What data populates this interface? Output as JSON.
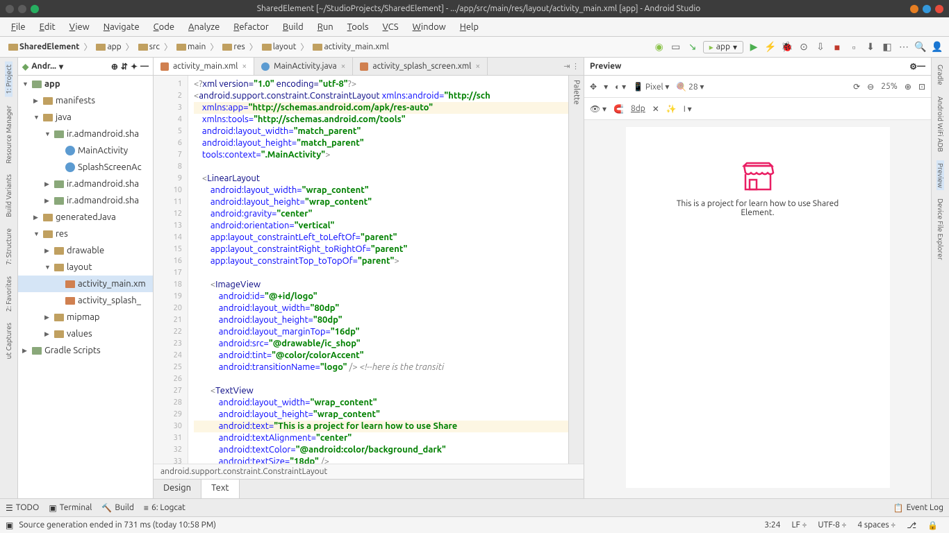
{
  "titlebar": "SharedElement [~/StudioProjects/SharedElement] - .../app/src/main/res/layout/activity_main.xml [app] - Android Studio",
  "menu": [
    "File",
    "Edit",
    "View",
    "Navigate",
    "Code",
    "Analyze",
    "Refactor",
    "Build",
    "Run",
    "Tools",
    "VCS",
    "Window",
    "Help"
  ],
  "breadcrumbs": [
    "SharedElement",
    "app",
    "src",
    "main",
    "res",
    "layout",
    "activity_main.xml"
  ],
  "runconfig": "app",
  "project": {
    "header": "Andr...",
    "nodes": [
      {
        "d": 0,
        "arr": "▼",
        "icon": "pkg",
        "label": "app",
        "bold": true
      },
      {
        "d": 1,
        "arr": "▶",
        "icon": "fic",
        "label": "manifests"
      },
      {
        "d": 1,
        "arr": "▼",
        "icon": "fic",
        "label": "java"
      },
      {
        "d": 2,
        "arr": "▼",
        "icon": "pkg",
        "label": "ir.admandroid.sha"
      },
      {
        "d": 3,
        "arr": "",
        "icon": "cls",
        "label": "MainActivity"
      },
      {
        "d": 3,
        "arr": "",
        "icon": "cls",
        "label": "SplashScreenAc"
      },
      {
        "d": 2,
        "arr": "▶",
        "icon": "pkg",
        "label": "ir.admandroid.sha"
      },
      {
        "d": 2,
        "arr": "▶",
        "icon": "pkg",
        "label": "ir.admandroid.sha"
      },
      {
        "d": 1,
        "arr": "▶",
        "icon": "fic",
        "label": "generatedJava"
      },
      {
        "d": 1,
        "arr": "▼",
        "icon": "fic",
        "label": "res"
      },
      {
        "d": 2,
        "arr": "▶",
        "icon": "fic",
        "label": "drawable"
      },
      {
        "d": 2,
        "arr": "▼",
        "icon": "fic",
        "label": "layout"
      },
      {
        "d": 3,
        "arr": "",
        "icon": "file",
        "label": "activity_main.xm",
        "sel": true
      },
      {
        "d": 3,
        "arr": "",
        "icon": "file",
        "label": "activity_splash_"
      },
      {
        "d": 2,
        "arr": "▶",
        "icon": "fic",
        "label": "mipmap"
      },
      {
        "d": 2,
        "arr": "▶",
        "icon": "fic",
        "label": "values"
      },
      {
        "d": 0,
        "arr": "▶",
        "icon": "pkg",
        "label": "Gradle Scripts"
      }
    ]
  },
  "tabs": [
    {
      "label": "activity_main.xml",
      "active": true,
      "icon": ""
    },
    {
      "label": "MainActivity.java",
      "active": false,
      "icon": "j"
    },
    {
      "label": "activity_splash_screen.xml",
      "active": false,
      "icon": ""
    }
  ],
  "palette_label": "Palette",
  "code_lines": [
    {
      "n": 1,
      "hl": false,
      "html": "<span class='g'>&lt;?</span><span class='t'>xml version=</span><span class='s'>\"1.0\"</span> <span class='t'>encoding=</span><span class='s'>\"utf-8\"</span><span class='g'>?&gt;</span>"
    },
    {
      "n": 2,
      "hl": false,
      "html": "<span class='g'>&lt;</span><span class='t'>android.support.constraint.ConstraintLayout</span> <span class='a'>xmlns:android=</span><span class='s'>\"http://sch</span>"
    },
    {
      "n": 3,
      "hl": true,
      "html": "    <span class='a'>xmlns:app=</span><span class='s'>\"http://schemas.android.com/apk/res-auto\"</span>"
    },
    {
      "n": 4,
      "hl": false,
      "html": "    <span class='a'>xmlns:tools=</span><span class='s'>\"http://schemas.android.com/tools\"</span>"
    },
    {
      "n": 5,
      "hl": false,
      "html": "    <span class='a'>android:layout_width=</span><span class='s'>\"match_parent\"</span>"
    },
    {
      "n": 6,
      "hl": false,
      "html": "    <span class='a'>android:layout_height=</span><span class='s'>\"match_parent\"</span>"
    },
    {
      "n": 7,
      "hl": false,
      "html": "    <span class='a'>tools:context=</span><span class='s'>\".MainActivity\"</span><span class='g'>&gt;</span>"
    },
    {
      "n": 8,
      "hl": false,
      "html": ""
    },
    {
      "n": 9,
      "hl": false,
      "html": "    <span class='g'>&lt;</span><span class='t'>LinearLayout</span>"
    },
    {
      "n": 10,
      "hl": false,
      "html": "        <span class='a'>android:layout_width=</span><span class='s'>\"wrap_content\"</span>"
    },
    {
      "n": 11,
      "hl": false,
      "html": "        <span class='a'>android:layout_height=</span><span class='s'>\"wrap_content\"</span>"
    },
    {
      "n": 12,
      "hl": false,
      "html": "        <span class='a'>android:gravity=</span><span class='s'>\"center\"</span>"
    },
    {
      "n": 13,
      "hl": false,
      "html": "        <span class='a'>android:orientation=</span><span class='s'>\"vertical\"</span>"
    },
    {
      "n": 14,
      "hl": false,
      "html": "        <span class='a'>app:layout_constraintLeft_toLeftOf=</span><span class='s'>\"parent\"</span>"
    },
    {
      "n": 15,
      "hl": false,
      "html": "        <span class='a'>app:layout_constraintRight_toRightOf=</span><span class='s'>\"parent\"</span>"
    },
    {
      "n": 16,
      "hl": false,
      "html": "        <span class='a'>app:layout_constraintTop_toTopOf=</span><span class='s'>\"parent\"</span><span class='g'>&gt;</span>"
    },
    {
      "n": 17,
      "hl": false,
      "html": ""
    },
    {
      "n": 18,
      "hl": false,
      "html": "        <span class='g'>&lt;</span><span class='t'>ImageView</span>"
    },
    {
      "n": 19,
      "hl": false,
      "html": "            <span class='a'>android:id=</span><span class='s'>\"@+id/logo\"</span>"
    },
    {
      "n": 20,
      "hl": false,
      "html": "            <span class='a'>android:layout_width=</span><span class='s'>\"80dp\"</span>"
    },
    {
      "n": 21,
      "hl": false,
      "html": "            <span class='a'>android:layout_height=</span><span class='s'>\"80dp\"</span>"
    },
    {
      "n": 22,
      "hl": false,
      "html": "            <span class='a'>android:layout_marginTop=</span><span class='s'>\"16dp\"</span>"
    },
    {
      "n": 23,
      "hl": false,
      "html": "            <span class='a'>android:src=</span><span class='s'>\"@drawable/ic_shop\"</span>"
    },
    {
      "n": 24,
      "hl": false,
      "html": "            <span class='a'>android:tint=</span><span class='s'>\"@color/colorAccent\"</span>"
    },
    {
      "n": 25,
      "hl": false,
      "html": "            <span class='a'>android:transitionName=</span><span class='s'>\"logo\"</span> <span class='g'>/&gt;</span> <span class='c'>&lt;!--here is the transiti</span>"
    },
    {
      "n": 26,
      "hl": false,
      "html": ""
    },
    {
      "n": 27,
      "hl": false,
      "html": "        <span class='g'>&lt;</span><span class='t'>TextView</span>"
    },
    {
      "n": 28,
      "hl": false,
      "html": "            <span class='a'>android:layout_width=</span><span class='s'>\"wrap_content\"</span>"
    },
    {
      "n": 29,
      "hl": false,
      "html": "            <span class='a'>android:layout_height=</span><span class='s'>\"wrap_content\"</span>"
    },
    {
      "n": 30,
      "hl": true,
      "html": "            <span class='a'>android:text=</span><span class='s'>\"This is a project for learn how to use Share</span>"
    },
    {
      "n": 31,
      "hl": false,
      "html": "            <span class='a'>android:textAlignment=</span><span class='s'>\"center\"</span>"
    },
    {
      "n": 32,
      "hl": false,
      "html": "            <span class='a'>android:textColor=</span><span class='s'>\"@android:color/background_dark\"</span>"
    },
    {
      "n": 33,
      "hl": false,
      "html": "            <span class='a'>android:textSize=</span><span class='s'>\"18dp\"</span> <span class='g'>/&gt;</span>"
    }
  ],
  "crumb_text": "android.support.constraint.ConstraintLayout",
  "designtabs": [
    "Design",
    "Text"
  ],
  "preview": {
    "title": "Preview",
    "device": "Pixel",
    "api": "28",
    "zoom": "25%",
    "sample_dp": "8dp",
    "text": "This is a project for learn how to use Shared Element."
  },
  "leftrail": [
    "1: Project",
    "Resource Manager",
    "Build Variants",
    "7: Structure",
    "2: Favorites",
    "ut Captures"
  ],
  "rightrail": [
    "Gradle",
    "Android WiFi ADB",
    "Preview",
    "Device File Explorer"
  ],
  "bottombar": [
    "TODO",
    "Terminal",
    "Build",
    "6: Logcat"
  ],
  "eventlog": "Event Log",
  "status": {
    "msg": "Source generation ended in 731 ms (today 10:58 PM)",
    "pos": "3:24",
    "le": "LF",
    "enc": "UTF-8",
    "ind": "4 spaces"
  }
}
